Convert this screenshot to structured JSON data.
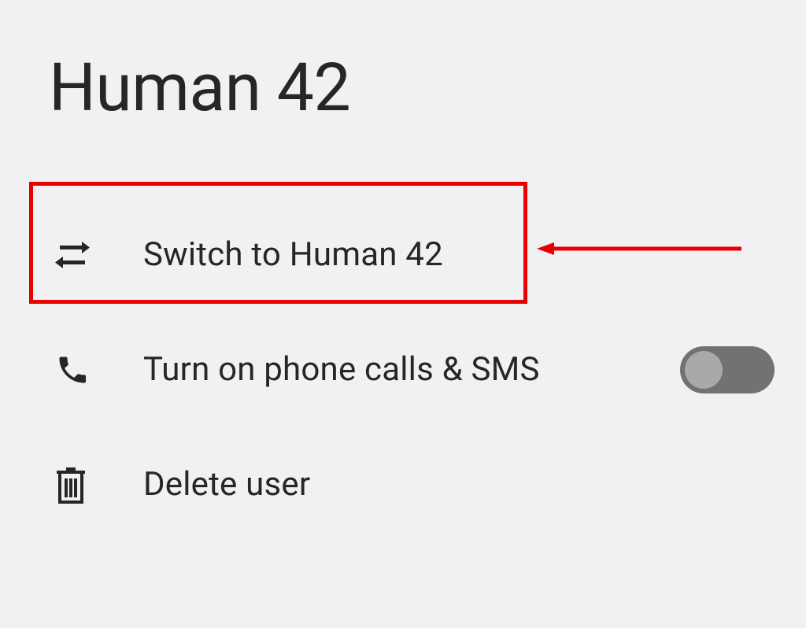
{
  "title": "Human 42",
  "rows": {
    "switch": {
      "label": "Switch to Human 42"
    },
    "phone": {
      "label": "Turn on phone calls & SMS",
      "toggle": false
    },
    "delete": {
      "label": "Delete user"
    }
  },
  "colors": {
    "annotation": "#e60000",
    "icon": "#262626",
    "toggle_track": "#737173",
    "toggle_knob": "#a9a9a9"
  }
}
